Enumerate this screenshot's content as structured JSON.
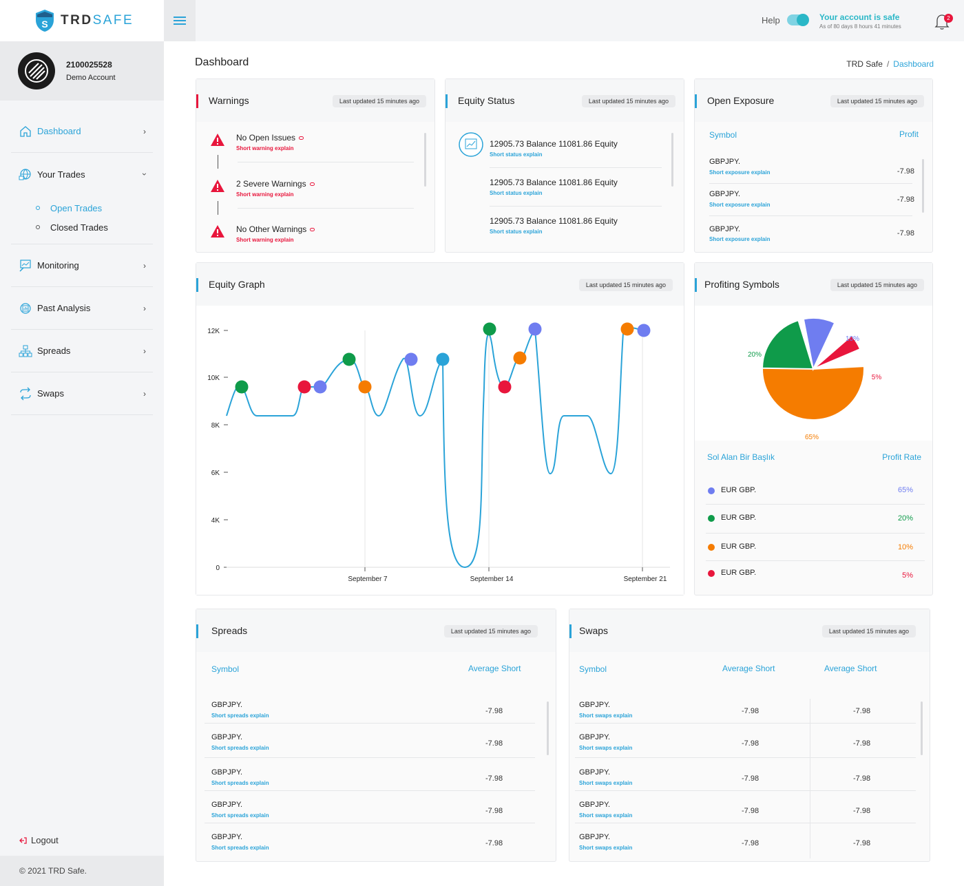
{
  "brand": {
    "name_part1": "TRD",
    "name_part2": "SAFE"
  },
  "account": {
    "id": "2100025528",
    "type": "Demo Account"
  },
  "sidebar": {
    "items": [
      {
        "label": "Dashboard",
        "icon": "home-icon"
      },
      {
        "label": "Your Trades",
        "icon": "globe-trades-icon"
      },
      {
        "label": "Monitoring",
        "icon": "monitoring-icon"
      },
      {
        "label": "Past Analysis",
        "icon": "analysis-icon"
      },
      {
        "label": "Spreads",
        "icon": "spreads-icon"
      },
      {
        "label": "Swaps",
        "icon": "swaps-icon"
      }
    ],
    "subitems": [
      {
        "label": "Open Trades"
      },
      {
        "label": "Closed Trades"
      }
    ],
    "logout": "Logout",
    "footer": "© 2021 TRD Safe."
  },
  "topbar": {
    "help": "Help",
    "safe_title": "Your account is safe",
    "safe_sub": "As of 80 days 8 hours 41 minutes",
    "notif_count": "2"
  },
  "page": {
    "title": "Dashboard",
    "breadcrumb": [
      "TRD Safe",
      "/",
      "Dashboard"
    ]
  },
  "updated_text": "Last updated 15 minutes ago",
  "warnings": {
    "title": "Warnings",
    "items": [
      {
        "title": "No Open Issues",
        "sub": "Short warning explain"
      },
      {
        "title": "2 Severe Warnings",
        "sub": "Short warning explain"
      },
      {
        "title": "No Other Warnings",
        "sub": "Short warning explain"
      }
    ]
  },
  "equity_status": {
    "title": "Equity Status",
    "items": [
      {
        "title": "12905.73 Balance 11081.86 Equity",
        "sub": "Short status explain"
      },
      {
        "title": "12905.73 Balance 11081.86 Equity",
        "sub": "Short status explain"
      },
      {
        "title": "12905.73 Balance 11081.86 Equity",
        "sub": "Short status explain"
      }
    ]
  },
  "open_exposure": {
    "title": "Open Exposure",
    "col_symbol": "Symbol",
    "col_profit": "Profit",
    "rows": [
      {
        "symbol": "GBPJPY.",
        "sub": "Short exposure explain",
        "profit": "-7.98"
      },
      {
        "symbol": "GBPJPY.",
        "sub": "Short exposure explain",
        "profit": "-7.98"
      },
      {
        "symbol": "GBPJPY.",
        "sub": "Short exposure explain",
        "profit": "-7.98"
      }
    ]
  },
  "equity_graph": {
    "title": "Equity Graph",
    "chart_data": {
      "type": "line",
      "title": "",
      "xlabel": "",
      "ylabel": "",
      "ylim": [
        0,
        12000
      ],
      "yticks": [
        "0",
        "4K",
        "6K",
        "8K",
        "10K",
        "12K"
      ],
      "xticks": [
        "September 7",
        "September 14",
        "September 21"
      ],
      "line_color": "#2aa3d8",
      "points_note_colors": [
        "#0f9b4a",
        "#e8163c",
        "#6f7df0",
        "#f57c00",
        "#2aa3d8"
      ]
    }
  },
  "profiting_symbols": {
    "title": "Profiting Symbols",
    "chart_data": {
      "type": "pie",
      "slices": [
        {
          "label": "65%",
          "value": 65,
          "color": "#f57c00"
        },
        {
          "label": "20%",
          "value": 20,
          "color": "#0f9b4a"
        },
        {
          "label": "10%",
          "value": 10,
          "color": "#6f7df0"
        },
        {
          "label": "5%",
          "value": 5,
          "color": "#e8163c"
        }
      ]
    },
    "col_left": "Sol Alan Bir Başlık",
    "col_right": "Profit Rate",
    "legend": [
      {
        "label": "EUR GBP.",
        "value": "65%",
        "color": "#6f7df0"
      },
      {
        "label": "EUR GBP.",
        "value": "20%",
        "color": "#0f9b4a"
      },
      {
        "label": "EUR GBP.",
        "value": "10%",
        "color": "#f57c00"
      },
      {
        "label": "EUR GBP.",
        "value": "5%",
        "color": "#e8163c"
      }
    ]
  },
  "spreads": {
    "title": "Spreads",
    "col_symbol": "Symbol",
    "col_avg": "Average Short",
    "rows": [
      {
        "symbol": "GBPJPY.",
        "sub": "Short spreads explain",
        "value": "-7.98"
      },
      {
        "symbol": "GBPJPY.",
        "sub": "Short spreads explain",
        "value": "-7.98"
      },
      {
        "symbol": "GBPJPY.",
        "sub": "Short spreads explain",
        "value": "-7.98"
      },
      {
        "symbol": "GBPJPY.",
        "sub": "Short spreads explain",
        "value": "-7.98"
      },
      {
        "symbol": "GBPJPY.",
        "sub": "Short spreads explain",
        "value": "-7.98"
      }
    ]
  },
  "swaps": {
    "title": "Swaps",
    "col_symbol": "Symbol",
    "col_avg1": "Average Short",
    "col_avg2": "Average Short",
    "rows": [
      {
        "symbol": "GBPJPY.",
        "sub": "Short swaps explain",
        "v1": "-7.98",
        "v2": "-7.98"
      },
      {
        "symbol": "GBPJPY.",
        "sub": "Short swaps explain",
        "v1": "-7.98",
        "v2": "-7.98"
      },
      {
        "symbol": "GBPJPY.",
        "sub": "Short swaps explain",
        "v1": "-7.98",
        "v2": "-7.98"
      },
      {
        "symbol": "GBPJPY.",
        "sub": "Short swaps explain",
        "v1": "-7.98",
        "v2": "-7.98"
      },
      {
        "symbol": "GBPJPY.",
        "sub": "Short swaps explain",
        "v1": "-7.98",
        "v2": "-7.98"
      }
    ]
  }
}
